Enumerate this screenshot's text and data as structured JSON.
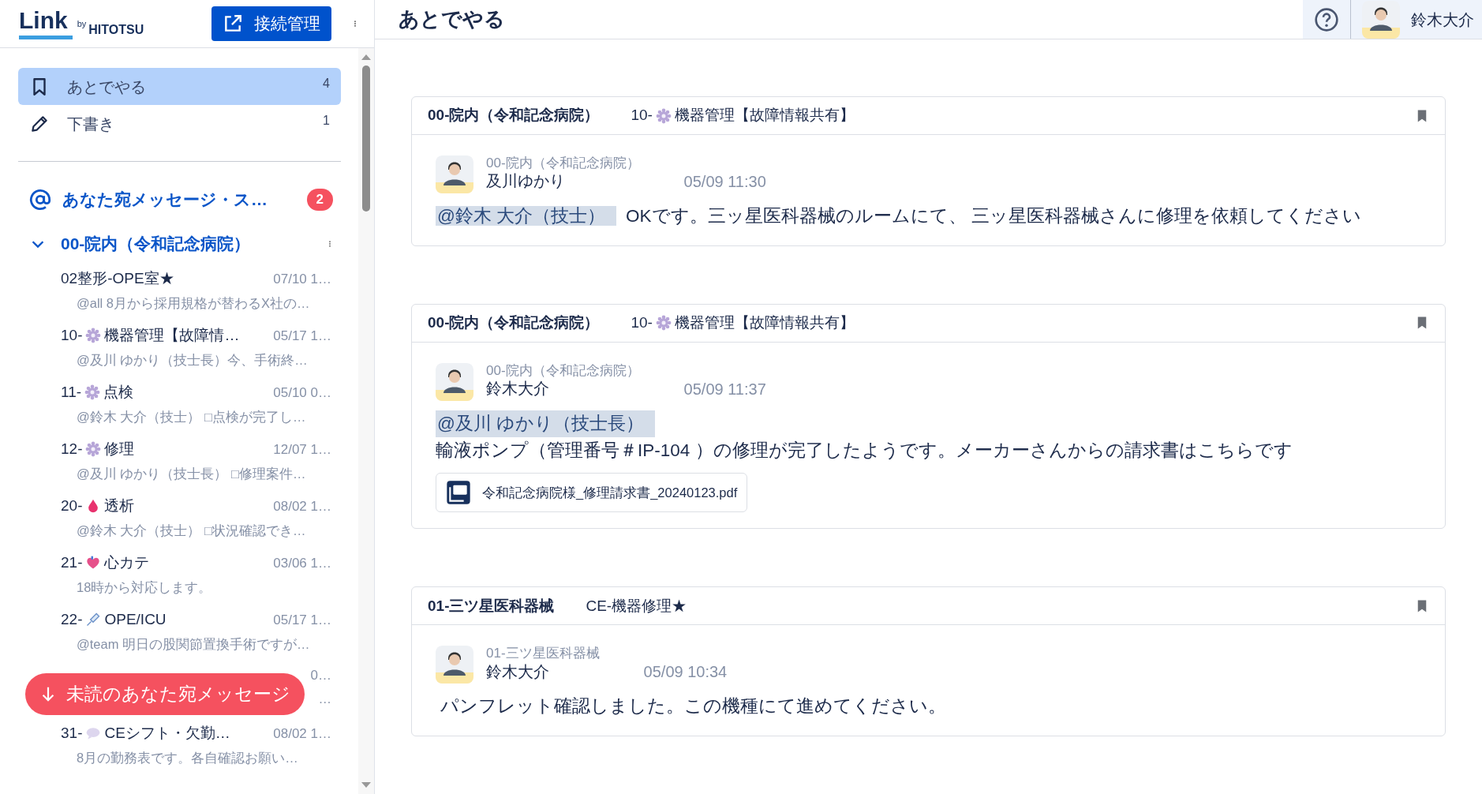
{
  "sidebar": {
    "logo": {
      "name": "Link",
      "by": "by",
      "brand": "HITOTSU"
    },
    "connect_button": "接続管理",
    "nav_items": [
      {
        "kind": "bookmark",
        "label": "あとでやる",
        "count": "4",
        "selected": true
      },
      {
        "kind": "pencil",
        "label": "下書き",
        "count": "1",
        "selected": false
      }
    ],
    "mentions": {
      "label": "あなた宛メッセージ・ス…",
      "badge": "2"
    },
    "group": {
      "label": "00-院内（令和記念病院）",
      "expanded": true,
      "channels": [
        {
          "kind": "none",
          "prefix": "02整形-OPE室★",
          "date": "07/10 1…",
          "preview": "@all 8月から採用規格が替わるX社の…"
        },
        {
          "kind": "gear",
          "prefix": "10-",
          "title": "機器管理【故障情…",
          "date": "05/17 1…",
          "preview": "@及川 ゆかり（技士長）今、手術終…"
        },
        {
          "kind": "gear",
          "prefix": "11-",
          "title": "点検",
          "date": "05/10 0…",
          "preview": "@鈴木 大介（技士） □点検が完了し…"
        },
        {
          "kind": "gear",
          "prefix": "12-",
          "title": "修理",
          "date": "12/07 1…",
          "preview": "@及川 ゆかり（技士長） □修理案件…"
        },
        {
          "kind": "drop",
          "prefix": "20-",
          "title": "透析",
          "date": "08/02 1…",
          "preview": "@鈴木 大介（技士） □状況確認でき…"
        },
        {
          "kind": "heart",
          "prefix": "21-",
          "title": "心カテ",
          "date": "03/06 1…",
          "preview": "18時から対応します。"
        },
        {
          "kind": "syringe",
          "prefix": "22-",
          "title": "OPE/ICU",
          "date": "05/17 1…",
          "preview": "@team 明日の股関節置換手術ですが…"
        },
        {
          "kind": "covered",
          "date": "0…",
          "preview": "…"
        },
        {
          "kind": "bubble",
          "prefix": "31-",
          "title": "CEシフト・欠勤…",
          "date": "08/02 1…",
          "preview": "8月の勤務表です。各自確認お願い…"
        }
      ]
    },
    "unread_button": "未読のあなた宛メッセージ"
  },
  "header": {
    "title": "あとでやる",
    "user": "鈴木大介"
  },
  "cards": [
    {
      "channel": "00-院内（令和記念病院）",
      "thread": {
        "kind": "gear",
        "prefix": "10-",
        "title": "機器管理【故障情報共有】"
      },
      "bookmarked": true,
      "message": {
        "kind": "inline",
        "channel": "00-院内（令和記念病院）",
        "sender": "及川ゆかり",
        "time": "05/09 11:30",
        "mention": "@鈴木 大介（技士）",
        "body": "OKです。三ッ星医科器械のルームにて、 三ッ星医科器械さんに修理を依頼してください"
      }
    },
    {
      "channel": "00-院内（令和記念病院）",
      "thread": {
        "kind": "gear",
        "prefix": "10-",
        "title": "機器管理【故障情報共有】"
      },
      "bookmarked": true,
      "message": {
        "kind": "block",
        "channel": "00-院内（令和記念病院）",
        "sender": "鈴木大介",
        "time": "05/09 11:37",
        "mention": "@及川 ゆかり（技士長）",
        "body": "輸液ポンプ（管理番号＃IP-104 ）の修理が完了したようです。メーカーさんからの請求書はこちらです",
        "attachment": "令和記念病院様_修理請求書_20240123.pdf"
      }
    },
    {
      "channel": "01-三ツ星医科器械",
      "thread": {
        "kind": "none",
        "title": "CE-機器修理★"
      },
      "bookmarked": true,
      "message": {
        "kind": "plain",
        "channel": "01-三ツ星医科器械",
        "sender": "鈴木大介",
        "time": "05/09 10:34",
        "body": "パンフレット確認しました。この機種にて進めてください。"
      }
    }
  ]
}
